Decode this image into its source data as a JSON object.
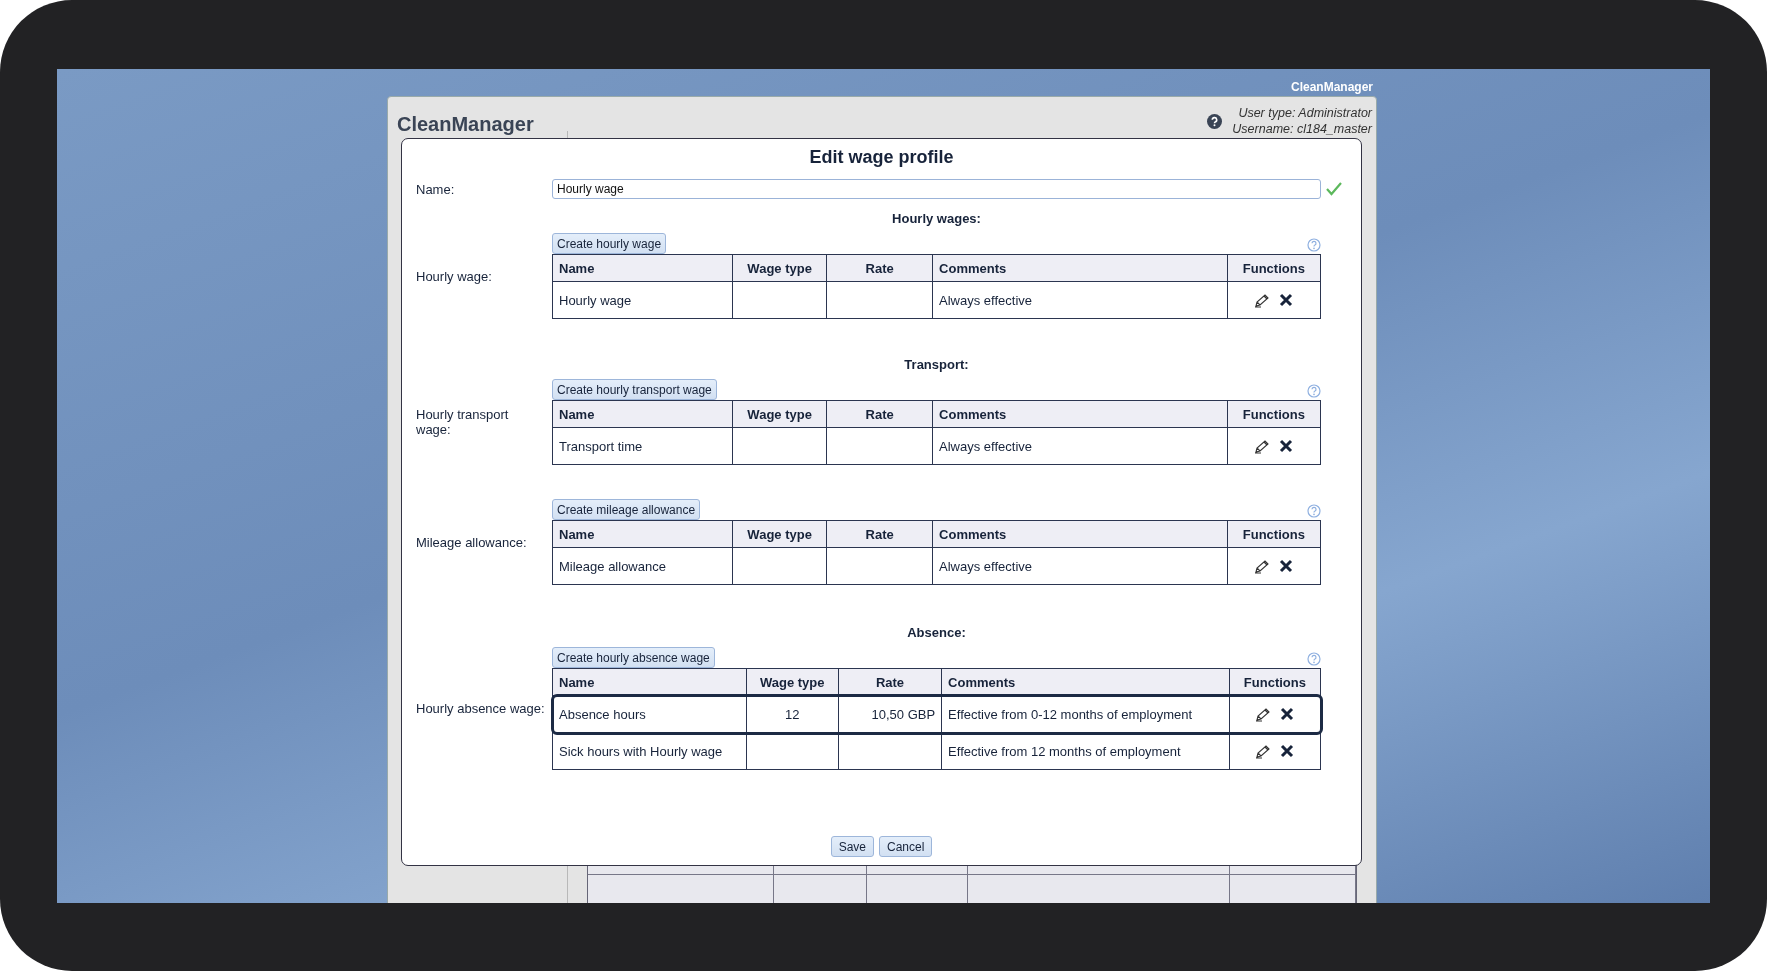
{
  "top_label": "CleanManager",
  "app": {
    "title": "CleanManager",
    "user_type": "User type: Administrator",
    "username": "Username: cl184_master"
  },
  "dialog": {
    "title": "Edit wage profile",
    "name_label": "Name:",
    "name_value": "Hourly wage",
    "name_valid": true,
    "sections": [
      {
        "heading": "Hourly wages:",
        "label": "Hourly wage:",
        "button": "Create hourly wage",
        "columns": [
          "Name",
          "Wage type",
          "Rate",
          "Comments",
          "Functions"
        ],
        "rows": [
          {
            "name": "Hourly wage",
            "comments": "Always effective",
            "selected": false
          }
        ]
      },
      {
        "heading": "Transport:",
        "label": "Hourly transport wage:",
        "button": "Create hourly transport wage",
        "columns": [
          "Name",
          "Wage type",
          "Rate",
          "Comments",
          "Functions"
        ],
        "rows": [
          {
            "name": "Transport time",
            "comments": "Always effective",
            "selected": false
          }
        ]
      },
      {
        "label": "Mileage allowance:",
        "button": "Create mileage allowance",
        "columns": [
          "Name",
          "Wage type",
          "Rate",
          "Comments",
          "Functions"
        ],
        "rows": [
          {
            "name": "Mileage allowance",
            "comments": "Always effective",
            "selected": false
          }
        ]
      },
      {
        "heading": "Absence:",
        "label": "Hourly absence wage:",
        "button": "Create hourly absence wage",
        "columns": [
          "Name",
          "Wage type",
          "Rate",
          "Comments",
          "Functions"
        ],
        "rows": [
          {
            "name": "Absence hours",
            "wage_type": "12",
            "rate": "10,50 GBP",
            "comments": "Effective from 0-12 months of employment",
            "selected": true
          },
          {
            "name": "Sick hours with Hourly wage",
            "comments": "Effective from 12 months of employment",
            "selected": false
          }
        ]
      }
    ],
    "buttons": [
      "Save",
      "Cancel"
    ]
  }
}
